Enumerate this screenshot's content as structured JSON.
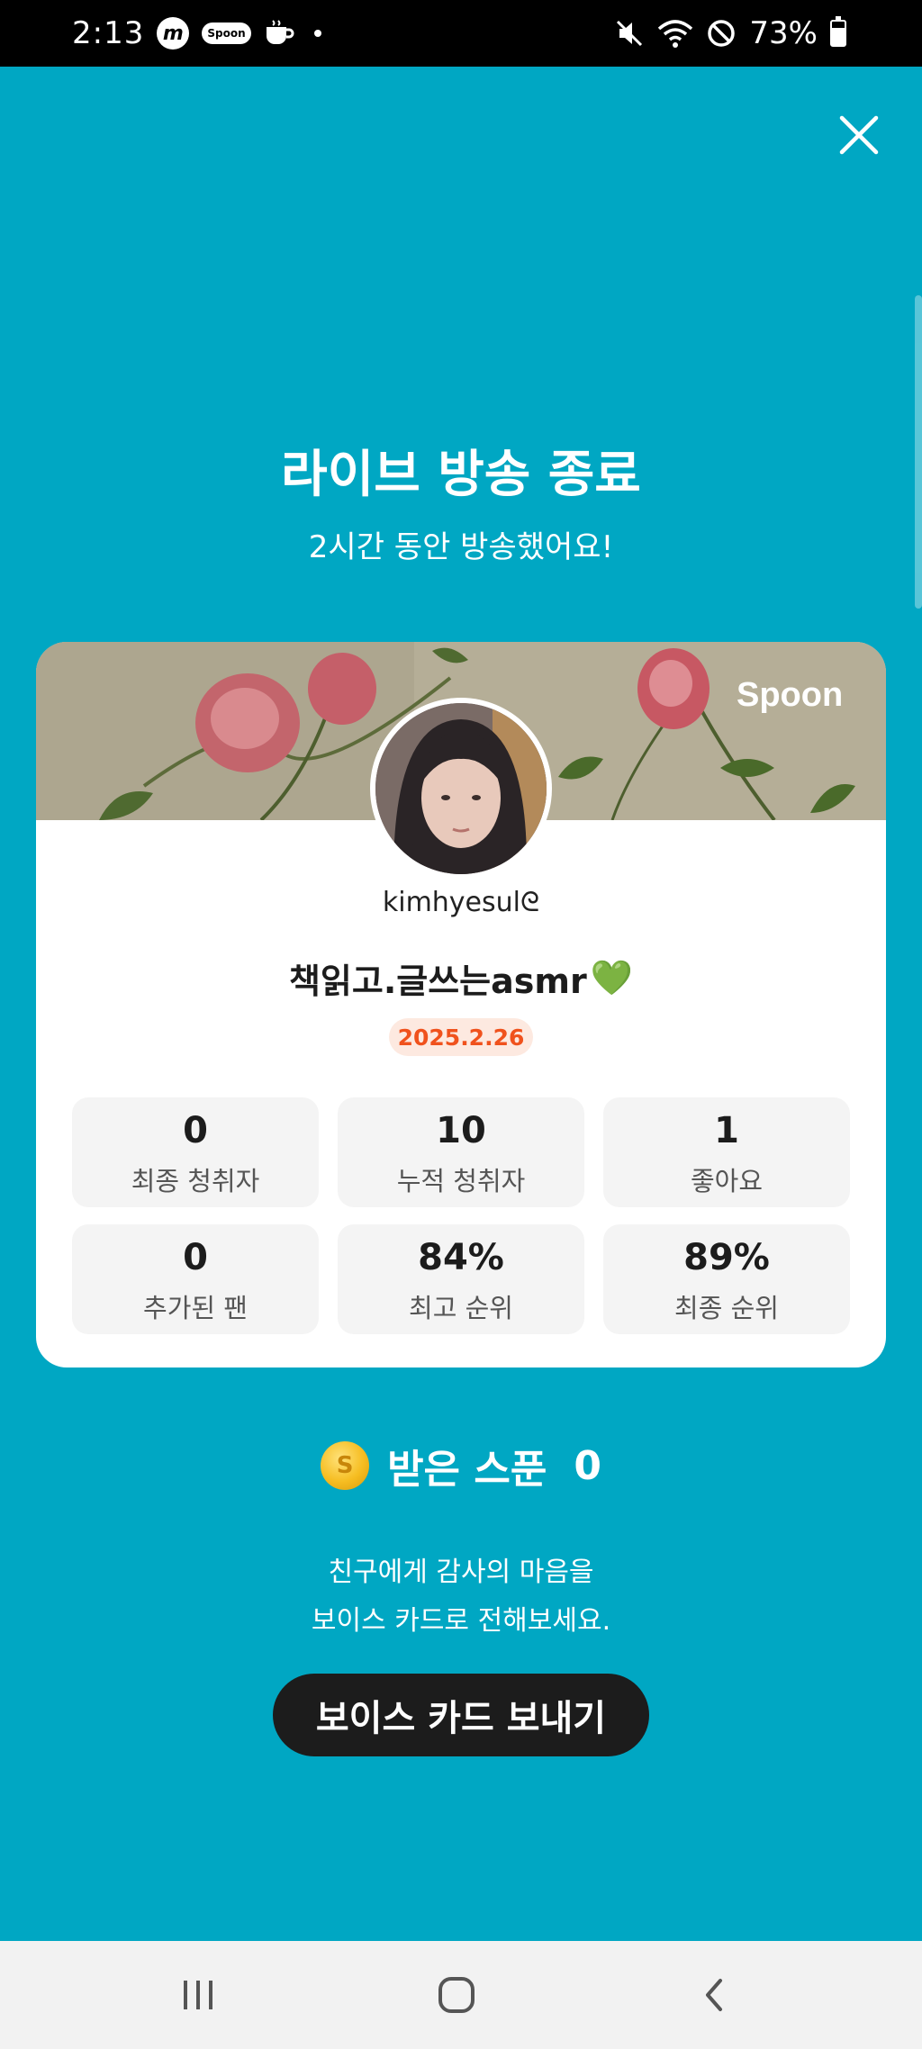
{
  "status_bar": {
    "time": "2:13",
    "app_icon_m": "m",
    "app_icon_spoon": "Spoon",
    "battery": "73%",
    "battery_level": 0.73
  },
  "header": {
    "title": "라이브 방송 종료",
    "subtitle": "2시간 동안 방송했어요!"
  },
  "card": {
    "brand": "Spoon",
    "username": "kimhyesulᘓ",
    "title": "책읽고.글쓰는asmr",
    "title_emoji": "💚",
    "date": "2025.2.26",
    "stats": [
      {
        "value": "0",
        "label": "최종 청취자"
      },
      {
        "value": "10",
        "label": "누적 청취자"
      },
      {
        "value": "1",
        "label": "좋아요"
      },
      {
        "value": "0",
        "label": "추가된 팬"
      },
      {
        "value": "84%",
        "label": "최고 순위"
      },
      {
        "value": "89%",
        "label": "최종 순위"
      }
    ]
  },
  "spoons": {
    "coin_symbol": "S",
    "label": "받은 스푼",
    "count": "0"
  },
  "message": {
    "line1": "친구에게 감사의 마음을",
    "line2": "보이스 카드로 전해보세요."
  },
  "voice_card_button": "보이스 카드 보내기",
  "colors": {
    "background": "#00a7c3",
    "button": "#1c1c1c",
    "date_badge_text": "#f0521d",
    "date_badge_bg": "#fde9e0"
  }
}
